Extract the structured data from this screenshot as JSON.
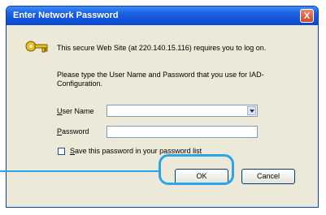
{
  "dialog": {
    "title": "Enter Network Password",
    "close_label": "X",
    "message_1": "This secure Web Site (at 220.140.15.116) requires you to log on.",
    "message_2": "Please type the User Name and Password that you use for IAD-Configuration.",
    "user_name": {
      "label_first": "U",
      "label_rest": "ser Name",
      "value": ""
    },
    "password": {
      "label_first": "P",
      "label_rest": "assword",
      "value": ""
    },
    "save_password": {
      "label_first": "S",
      "label_rest": "ave this password in your password list",
      "checked": false
    },
    "ok_label": "OK",
    "cancel_label": "Cancel"
  },
  "colors": {
    "highlight": "#2aa5e8",
    "titlebar": "#0848d0"
  },
  "icons": {
    "key": "key-icon",
    "close": "close-icon",
    "dropdown": "chevron-down-icon"
  }
}
